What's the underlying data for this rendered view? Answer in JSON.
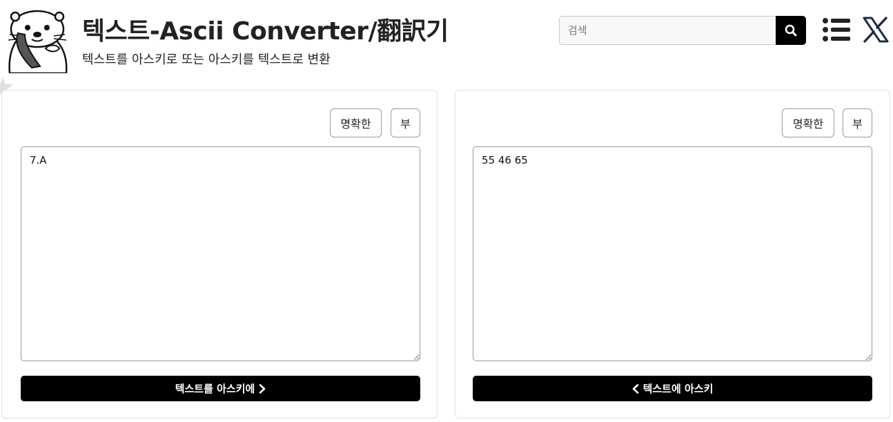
{
  "header": {
    "title": "텍스트-Ascii Converter/翻訳기",
    "subtitle": "텍스트를 아스키로 또는 아스키를 텍스트로 변환",
    "logo_icon": "otter-mascot-icon",
    "search": {
      "placeholder": "검색",
      "value": "",
      "icon": "search-icon"
    },
    "menu_icon": "list-menu-icon",
    "social_icon": "x-logo-icon"
  },
  "panels": [
    {
      "id": "text",
      "clear_label": "명확한",
      "copy_label": "부",
      "content": "7.A",
      "convert_label": "텍스트를 아스키에",
      "convert_icon": "chevron-right-icon"
    },
    {
      "id": "ascii",
      "clear_label": "명확한",
      "copy_label": "부",
      "content": "55 46 65",
      "convert_label": "텍스트에 아스키",
      "convert_icon": "chevron-left-icon"
    }
  ],
  "colors": {
    "primary": "#000000",
    "text": "#222222",
    "border": "#999999",
    "panel_border": "#e2e2e2",
    "search_bg": "#f8f8f8"
  }
}
